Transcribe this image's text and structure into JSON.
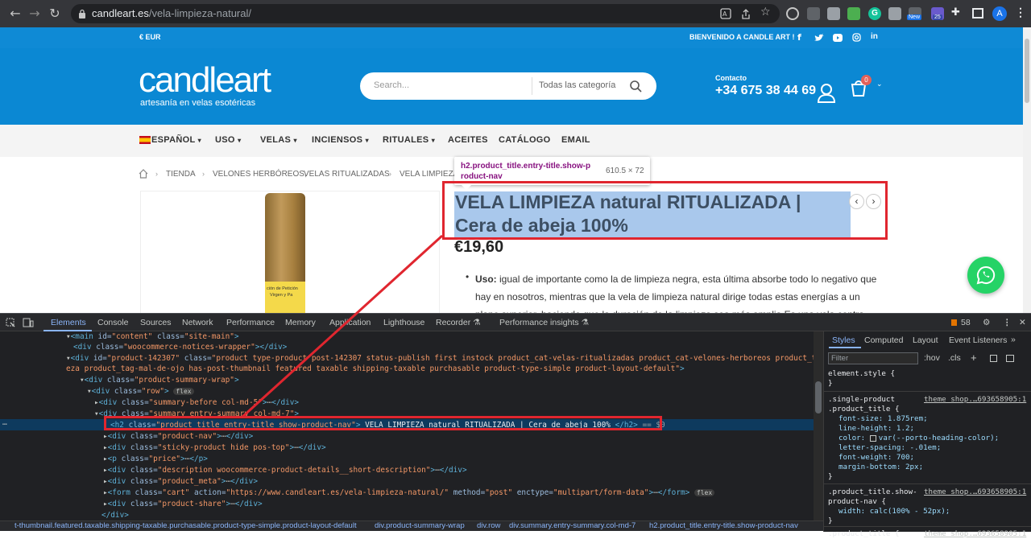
{
  "browser": {
    "url_domain": "candleart.es",
    "url_path": "/vela-limpieza-natural/",
    "ext_badge_new": "New",
    "ext_badge_count": "25",
    "profile_letter": "A"
  },
  "topbar": {
    "currency": "€ EUR",
    "welcome": "BIENVENIDO A CANDLE ART !"
  },
  "header": {
    "logo_text": "candleart",
    "logo_tagline": "artesanía en velas esotéricas",
    "search_placeholder": "Search...",
    "category_select": "Todas las categoría",
    "contact_label": "Contacto",
    "contact_phone": "+34 675 38 44 69",
    "cart_count": "0"
  },
  "menu": {
    "items": [
      "ESPAÑOL",
      "USO",
      "VELAS",
      "INCIENSOS",
      "RITUALES",
      "ACEITES",
      "CATÁLOGO",
      "EMAIL"
    ]
  },
  "breadcrumb": {
    "items": [
      "TIENDA",
      "VELONES HERBÓREOS,",
      "VELAS RITUALIZADAS",
      "VELA LIMPIEZA"
    ]
  },
  "product": {
    "title": "VELA LIMPIEZA natural RITUALIZADA | Cera de abeja 100%",
    "price": "€19,60",
    "desc_label": "Uso:",
    "desc_line1": "igual de importante como la de limpieza negra, esta última absorbe todo lo negativo que",
    "desc_line2": "hay en nosotros, mientras que la vela de limpieza natural dirige todas estas energías  a un",
    "desc_line3": "plano superior, haciendo que la duración de la limpieza sea más amplia Es una vela contra",
    "label_line1": "ción de Petición",
    "label_line2": "Virgen y Pa"
  },
  "tooltip": {
    "selector": "h2.product_title.entry-title.show-p",
    "selector2": "roduct-nav",
    "size": "610.5 × 72"
  },
  "devtools": {
    "tabs": [
      "Elements",
      "Console",
      "Sources",
      "Network",
      "Performance",
      "Memory",
      "Application",
      "Lighthouse",
      "Recorder",
      "Performance insights"
    ],
    "issues_count": "58",
    "styles_tabs": [
      "Styles",
      "Computed",
      "Layout",
      "Event Listeners"
    ],
    "filter_placeholder": "Filter",
    "hov": ":hov",
    "cls": ".cls",
    "element_style": "element.style {",
    "rule1_selector": ".single-product",
    "rule1_selector2": ".product_title {",
    "rule1_source": "theme_shop.…693658905:1",
    "rule1_props": [
      "font-size: 1.875rem;",
      "line-height: 1.2;",
      "color:   var(--porto-heading-color);",
      "letter-spacing: -.01em;",
      "font-weight: 700;",
      "margin-bottom: 2px;"
    ],
    "rule2_selector": ".product_title.show-",
    "rule2_selector2": "product-nav {",
    "rule2_source": "theme_shop.…693658905:1",
    "rule2_props": [
      "width: calc(100% - 52px);"
    ],
    "rule3_selector": ".product_title {",
    "rule3_source": "theme_shop.…693658905:1",
    "crumbs": [
      "t-thumbnail.featured.taxable.shipping-taxable.purchasable.product-type-simple.product-layout-default",
      "div.product-summary-wrap",
      "div.row",
      "div.summary.entry-summary.col-md-7",
      "h2.product_title.entry-title.show-product-nav"
    ]
  }
}
